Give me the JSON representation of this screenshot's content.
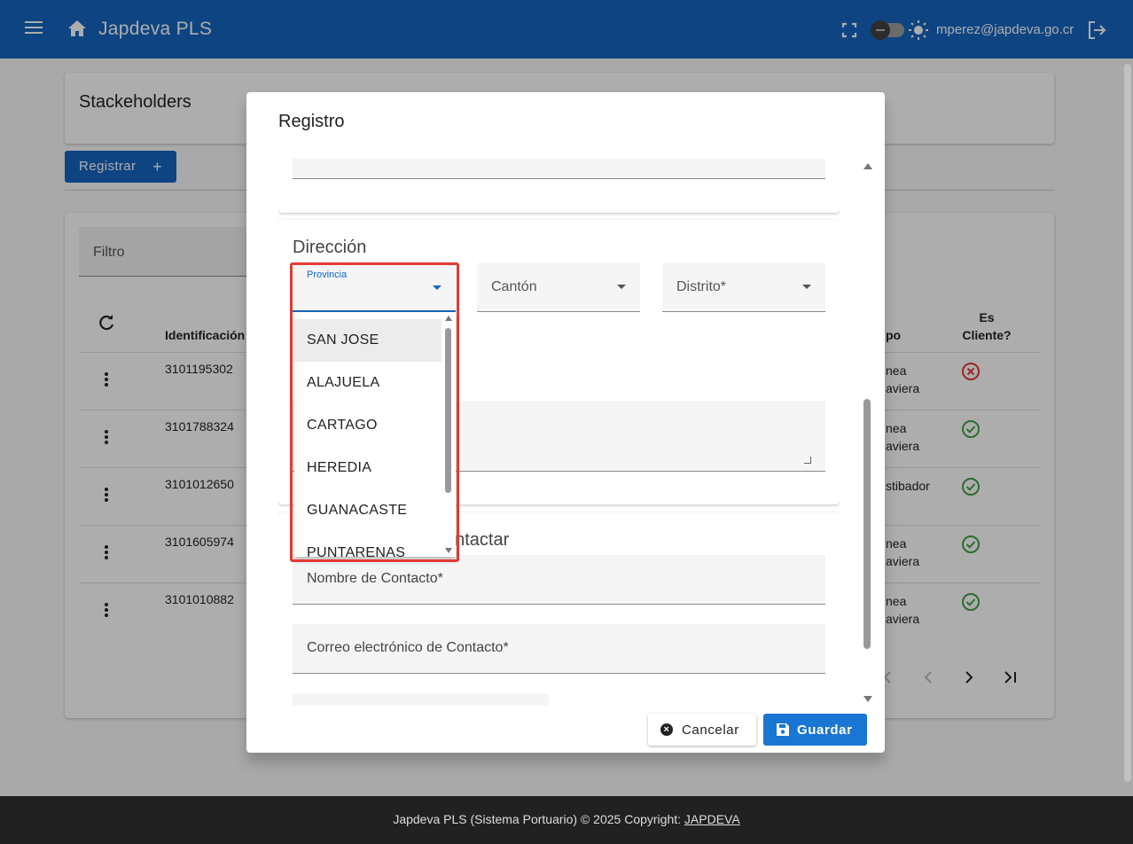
{
  "app": {
    "title": "Japdeva PLS",
    "user_email": "mperez@japdeva.go.cr",
    "icons": [
      "menu-icon",
      "home-icon",
      "fullscreen-icon",
      "theme-toggle",
      "sun-icon",
      "logout-icon"
    ]
  },
  "page": {
    "heading": "Stackeholders",
    "register_button": "Registrar",
    "register_icon": "+",
    "filter_label": "Filtro",
    "columns": {
      "identification": "Identificación",
      "tipo": "po",
      "es_cliente": "Es Cliente?"
    },
    "rows": [
      {
        "id": "3101195302",
        "tipo": "nea\naviera",
        "es_cliente": false
      },
      {
        "id": "3101788324",
        "tipo": "nea\naviera",
        "es_cliente": true
      },
      {
        "id": "3101012650",
        "tipo": "stibador",
        "es_cliente": true
      },
      {
        "id": "3101605974",
        "tipo": "nea\naviera",
        "es_cliente": true
      },
      {
        "id": "3101010882",
        "tipo": "nea\naviera",
        "es_cliente": true
      }
    ]
  },
  "dialog": {
    "title": "Registro",
    "direccion_title": "Dirección",
    "provincia_label": "Provincia",
    "canton_label": "Cantón",
    "distrito_label": "Distrito*",
    "contact_title_partial": "ontactar",
    "contact_name_label": "Nombre de Contacto*",
    "contact_email_label": "Correo electrónico de Contacto*",
    "cancel_label": "Cancelar",
    "save_label": "Guardar",
    "provincia_options": [
      "SAN JOSE",
      "ALAJUELA",
      "CARTAGO",
      "HEREDIA",
      "GUANACASTE",
      "PUNTARENAS"
    ]
  },
  "colors": {
    "primary": "#1565c0",
    "highlight_border": "#e53935",
    "status_yes": "#43a047",
    "status_no": "#e53935"
  },
  "footer": {
    "text": "Japdeva PLS (Sistema Portuario) © 2025 Copyright:",
    "link": "JAPDEVA"
  }
}
